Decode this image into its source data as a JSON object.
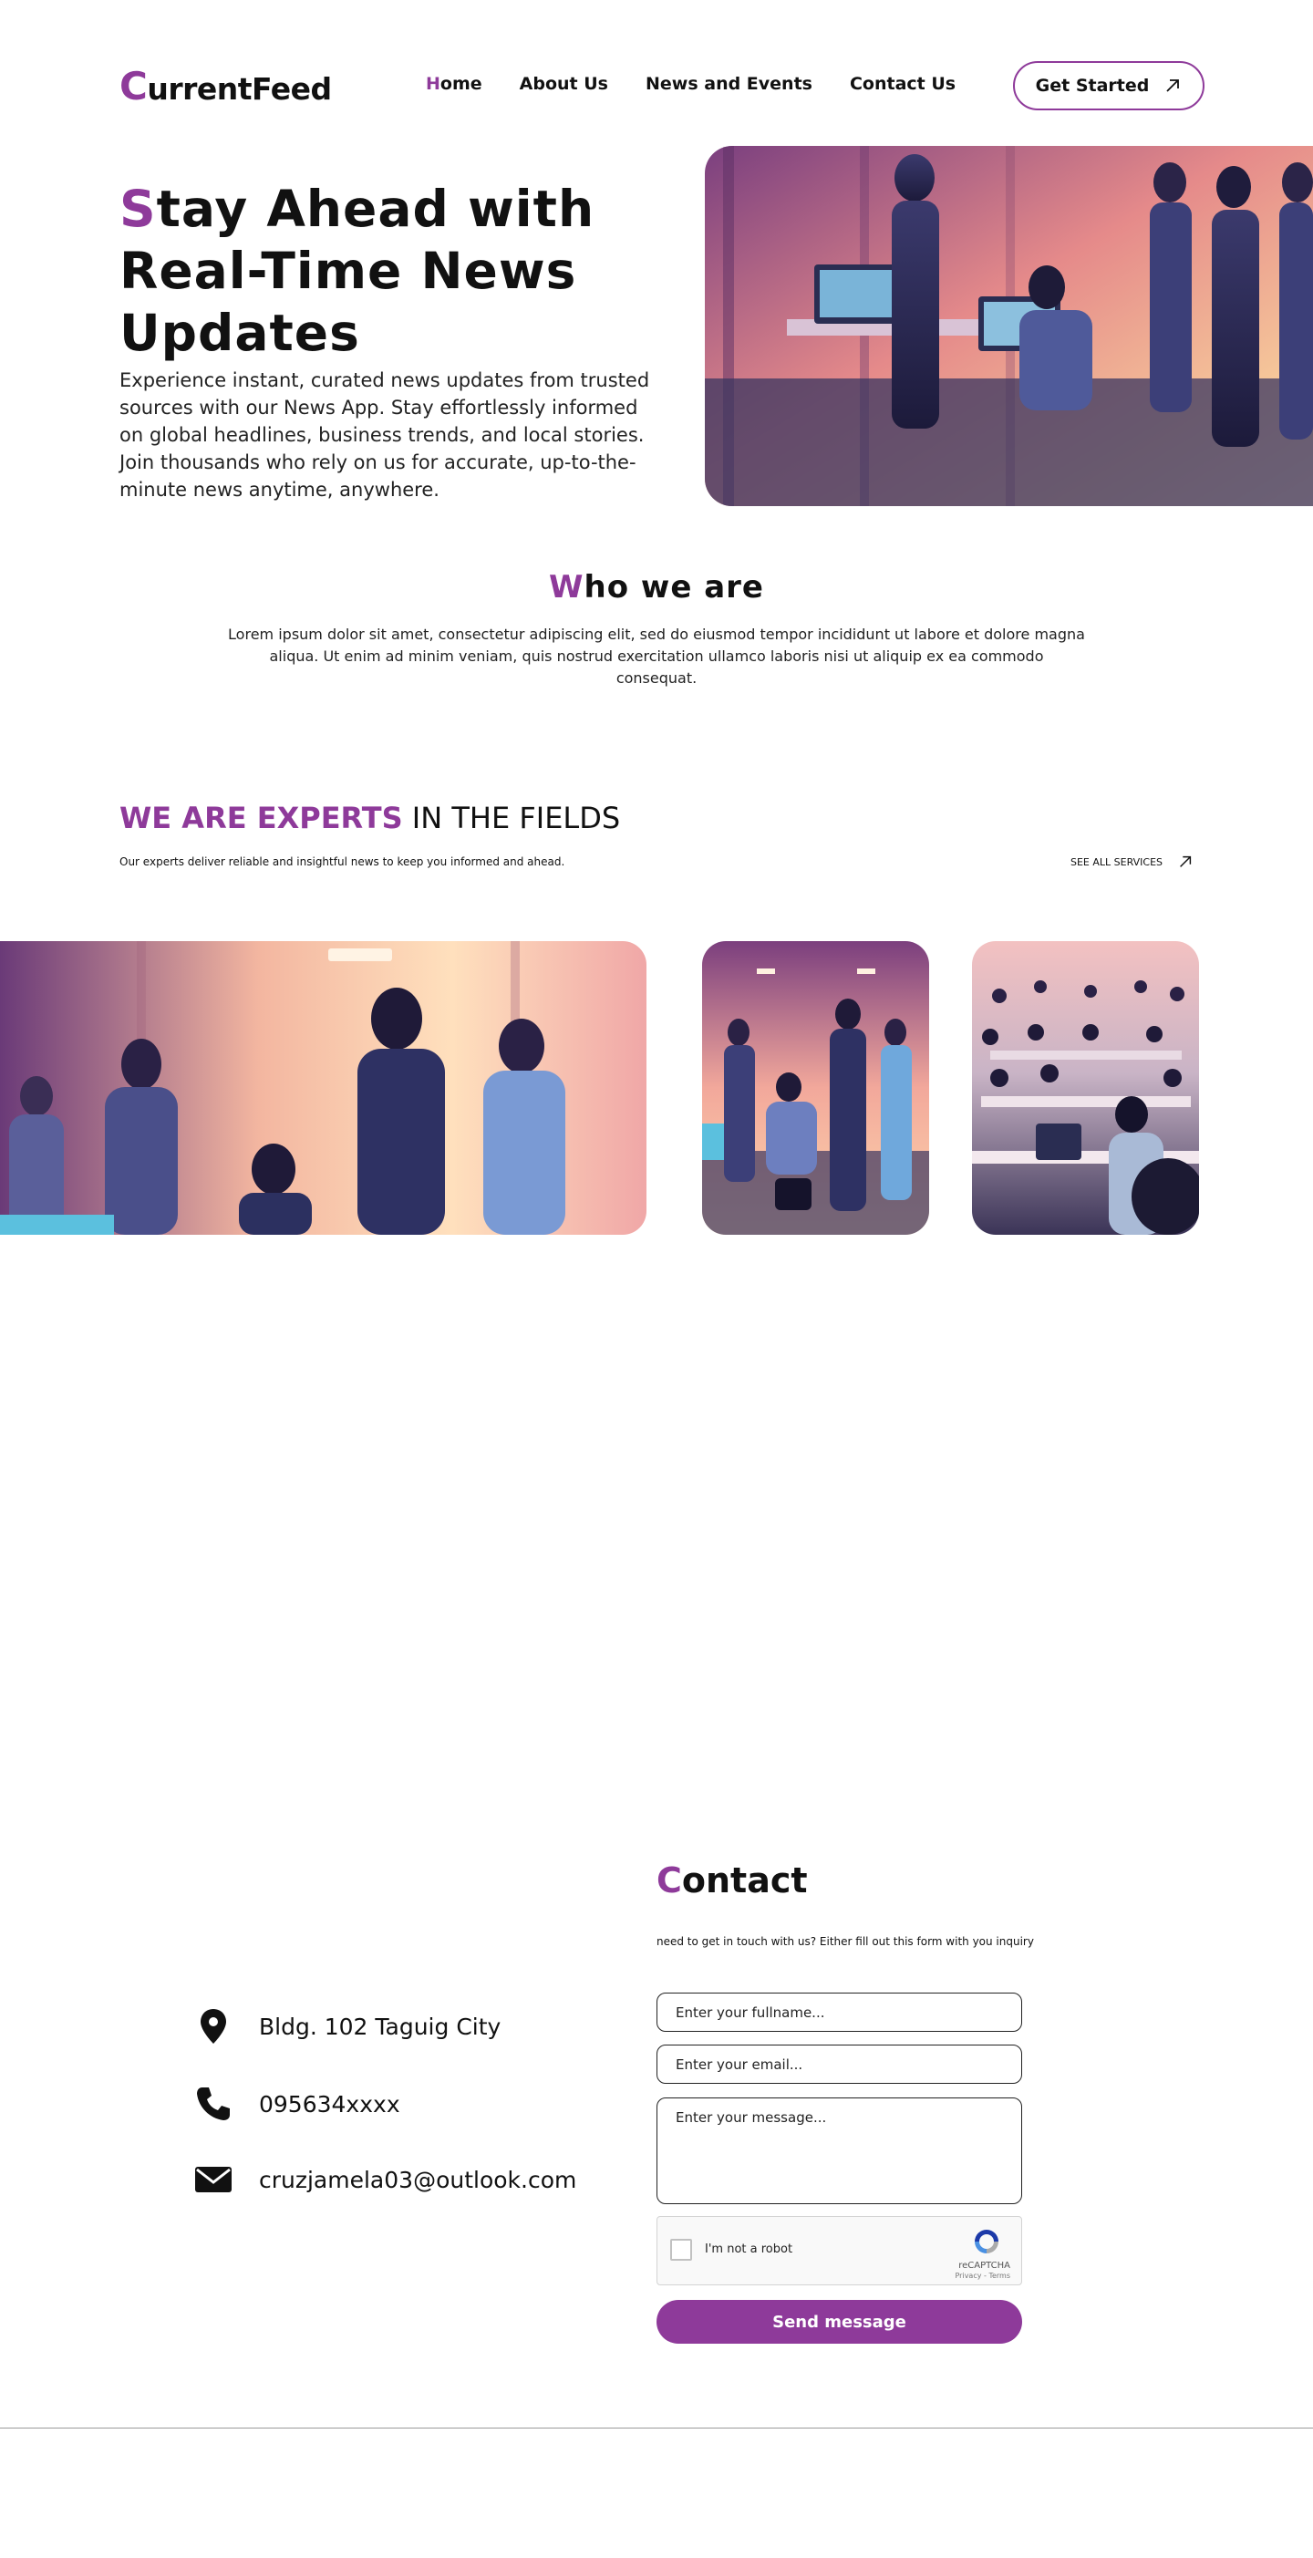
{
  "brand": {
    "initial": "C",
    "rest": "urrentFeed"
  },
  "nav": {
    "home_initial": "H",
    "home_rest": "ome",
    "about": "About Us",
    "news": "News and Events",
    "contact": "Contact Us"
  },
  "header": {
    "cta_label": "Get Started",
    "cta_icon": "arrow-up-right-icon"
  },
  "hero": {
    "title_initial": "S",
    "title_rest": "tay Ahead with Real-Time News Updates",
    "body": "Experience instant, curated news updates from trusted sources with our News App. Stay effortlessly informed on global headlines, business trends, and local stories. Join thousands who rely on us for accurate, up-to-the-minute news anytime, anywhere."
  },
  "who": {
    "title_initial": "W",
    "title_rest": "ho we are",
    "body": "Lorem ipsum dolor sit amet, consectetur adipiscing elit, sed do eiusmod tempor incididunt ut labore et dolore magna aliqua. Ut enim ad minim veniam, quis nostrud exercitation ullamco laboris nisi ut aliquip ex ea commodo consequat."
  },
  "experts": {
    "title_accent": "WE ARE EXPERTS",
    "title_rest": " IN THE FIELDS",
    "subtitle": "Our experts deliver reliable and insightful news to keep you informed and ahead.",
    "see_all": "SEE ALL SERVICES"
  },
  "contact_info": {
    "address": "Bldg. 102 Taguig City",
    "phone": "095634xxxx",
    "email": "cruzjamela03@outlook.com",
    "icons": [
      "location-pin-icon",
      "phone-icon",
      "envelope-icon"
    ]
  },
  "contact_form": {
    "title_initial": "C",
    "title_rest": "ontact",
    "subtitle": "need to get in touch with us? Either fill out this form with you inquiry",
    "name_placeholder": "Enter your fullname...",
    "email_placeholder": "Enter your email...",
    "message_placeholder": "Enter your message...",
    "captcha_label": "I'm not a robot",
    "captcha_brand": "reCAPTCHA",
    "captcha_terms": "Privacy - Terms",
    "submit_label": "Send message"
  },
  "colors": {
    "accent": "#8e3a9a",
    "text": "#111111",
    "background": "#ffffff"
  }
}
